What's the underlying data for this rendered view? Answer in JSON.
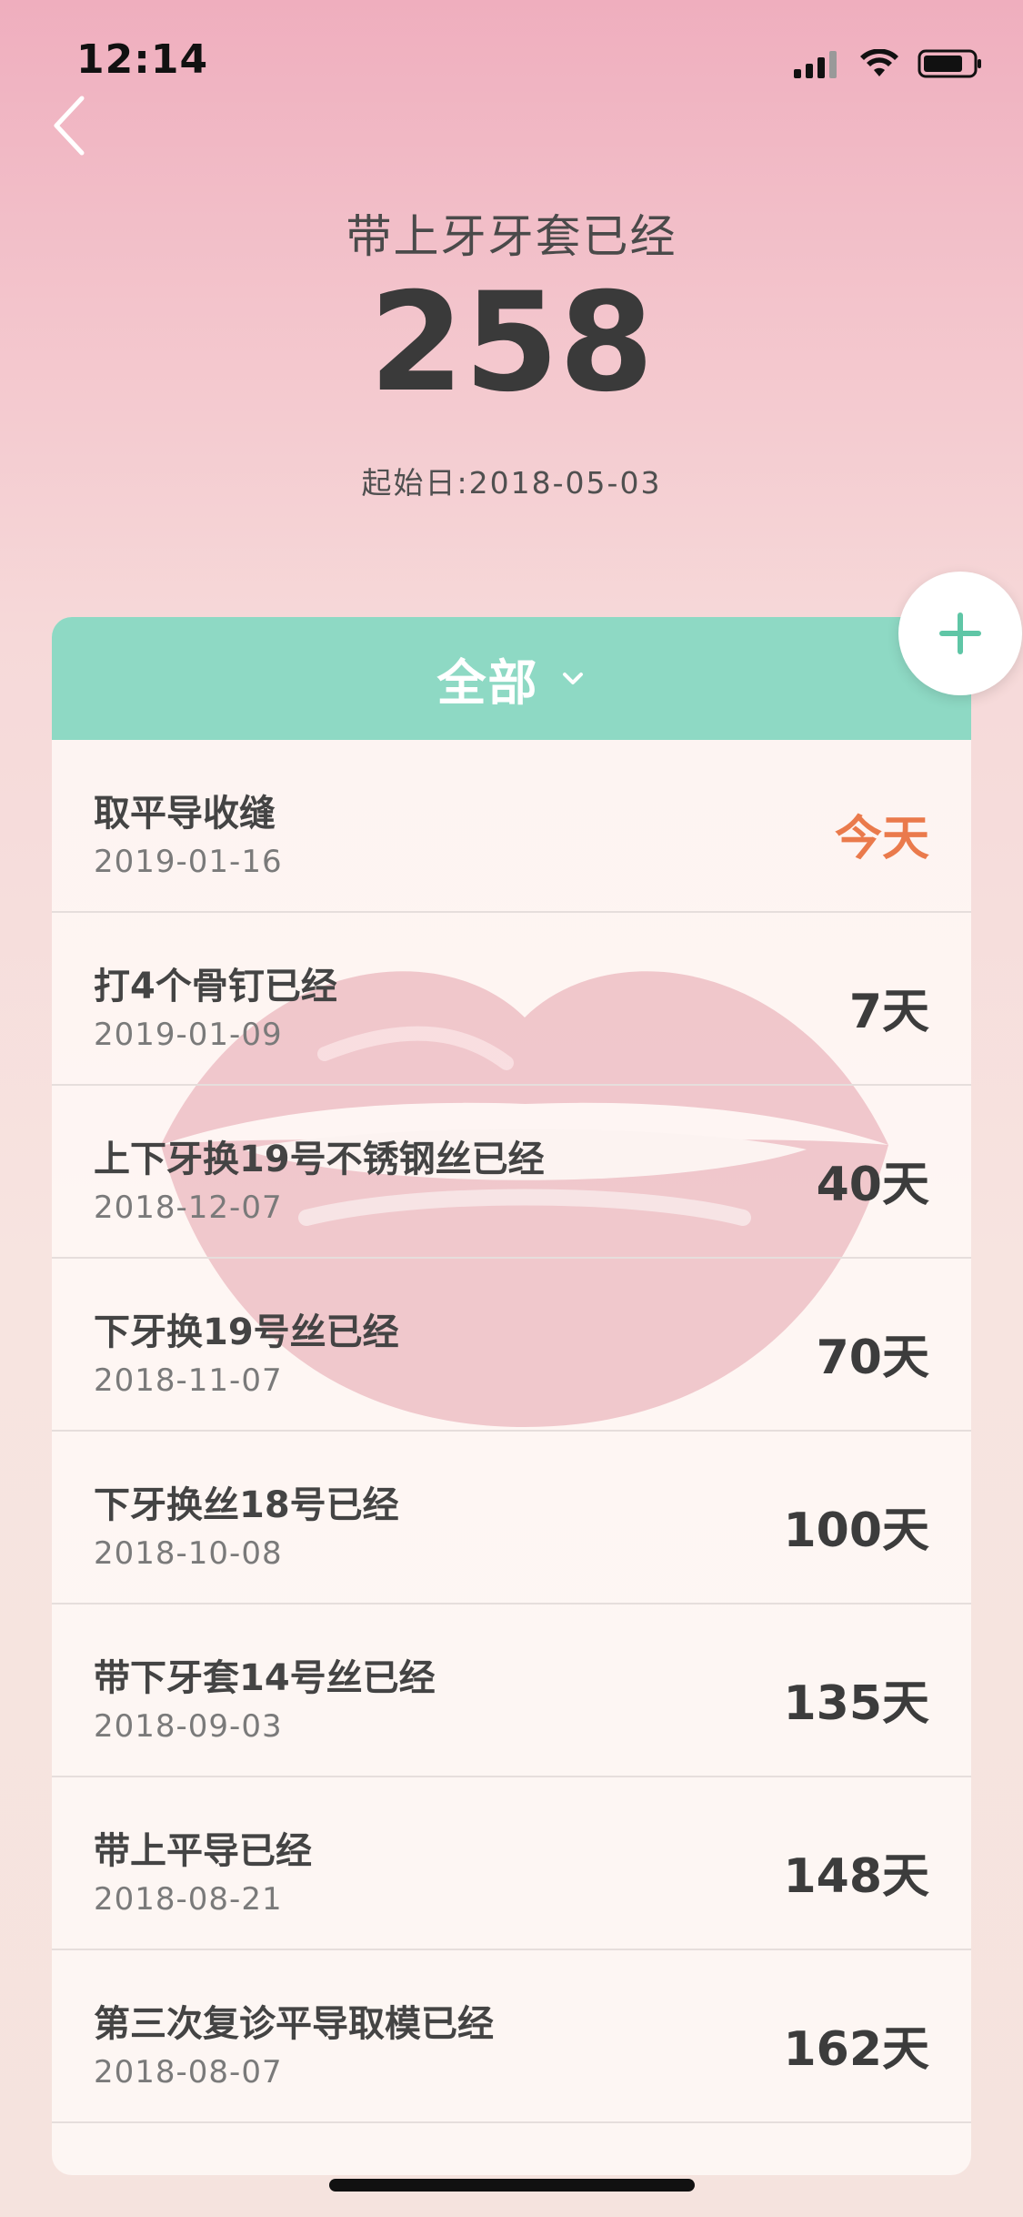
{
  "status_bar": {
    "time": "12:14",
    "icons": [
      "cellular-signal-icon",
      "wifi-icon",
      "battery-icon"
    ]
  },
  "nav": {
    "back_icon": "chevron-left-icon"
  },
  "summary": {
    "label": "带上牙牙套已经",
    "count": "258",
    "start_date": "起始日:2018-05-03"
  },
  "filter": {
    "label": "全部",
    "icon": "chevron-down-icon"
  },
  "add_button": {
    "icon": "plus-icon"
  },
  "colors": {
    "accent_green": "#8ed9c4",
    "today_orange": "#ea7a4c",
    "plus_green": "#5fc6a6"
  },
  "items": [
    {
      "title": "取平导收缝",
      "date": "2019-01-16",
      "days": "今天",
      "today": true
    },
    {
      "title": "打4个骨钉已经",
      "date": "2019-01-09",
      "days": "7天",
      "today": false
    },
    {
      "title": "上下牙换19号不锈钢丝已经",
      "date": "2018-12-07",
      "days": "40天",
      "today": false
    },
    {
      "title": "下牙换19号丝已经",
      "date": "2018-11-07",
      "days": "70天",
      "today": false
    },
    {
      "title": "下牙换丝18号已经",
      "date": "2018-10-08",
      "days": "100天",
      "today": false
    },
    {
      "title": "带下牙套14号丝已经",
      "date": "2018-09-03",
      "days": "135天",
      "today": false
    },
    {
      "title": "带上平导已经",
      "date": "2018-08-21",
      "days": "148天",
      "today": false
    },
    {
      "title": "第三次复诊平导取模已经",
      "date": "2018-08-07",
      "days": "162天",
      "today": false
    }
  ]
}
